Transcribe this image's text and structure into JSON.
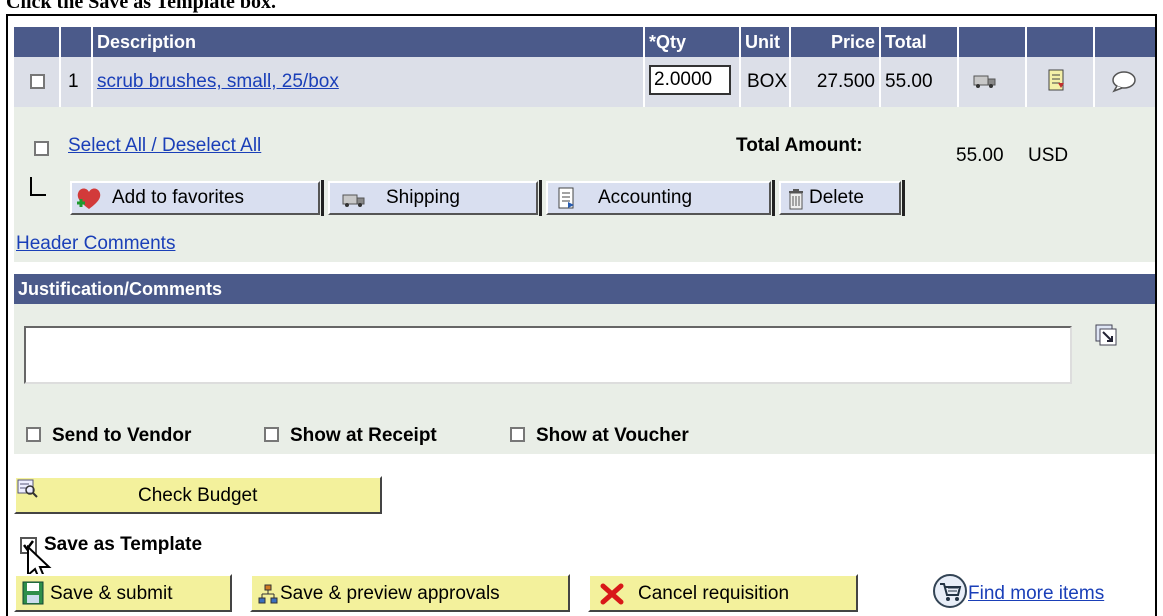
{
  "instruction": "Click the Save as Template box.",
  "grid": {
    "headers": {
      "description": "Description",
      "qty": "*Qty",
      "unit": "Unit",
      "price": "Price",
      "total": "Total"
    },
    "row": {
      "line": "1",
      "description": "scrub brushes, small, 25/box",
      "qty": "2.0000",
      "unit": "BOX",
      "price": "27.500",
      "total": "55.00"
    }
  },
  "summary": {
    "select_all": "Select All / Deselect All",
    "total_amount_label": "Total Amount:",
    "total_amount": "55.00",
    "currency": "USD",
    "buttons": {
      "favorites": "Add to favorites",
      "shipping": "Shipping",
      "accounting": "Accounting",
      "delete": "Delete"
    },
    "header_comments": "Header Comments"
  },
  "comments": {
    "title": "Justification/Comments",
    "value": "",
    "send_to_vendor": "Send to Vendor",
    "show_at_receipt": "Show at Receipt",
    "show_at_voucher": "Show at Voucher"
  },
  "actions": {
    "check_budget": "Check Budget",
    "save_as_template": "Save as Template",
    "save_as_template_checked": true,
    "save_submit": "Save & submit",
    "save_preview": "Save & preview approvals",
    "cancel": "Cancel requisition",
    "find_more": "Find more items"
  },
  "colors": {
    "header_bg": "#4b5a8a",
    "row_bg": "#dcdfe8",
    "panel_bg": "#e9eee7",
    "link": "#1a3fb8",
    "yellow_button": "#f3f19c"
  }
}
